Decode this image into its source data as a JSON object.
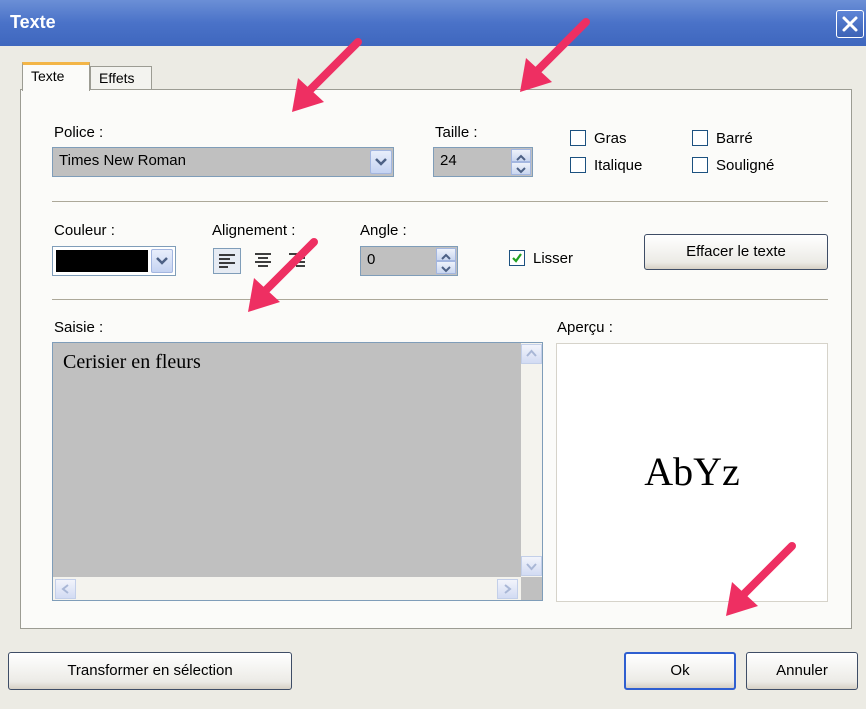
{
  "window": {
    "title": "Texte"
  },
  "tabs": [
    {
      "label": "Texte"
    },
    {
      "label": "Effets"
    }
  ],
  "font": {
    "label": "Police :",
    "value": "Times New Roman"
  },
  "size": {
    "label": "Taille :",
    "value": "24"
  },
  "styles": {
    "bold": {
      "label": "Gras",
      "checked": false
    },
    "strike": {
      "label": "Barré",
      "checked": false
    },
    "italic": {
      "label": "Italique",
      "checked": false
    },
    "underline": {
      "label": "Souligné",
      "checked": false
    }
  },
  "color": {
    "label": "Couleur :",
    "value_hex": "#000000"
  },
  "alignment": {
    "label": "Alignement :",
    "selected": "left"
  },
  "angle": {
    "label": "Angle :",
    "value": "0"
  },
  "smooth": {
    "label": "Lisser",
    "checked": true
  },
  "clear_button": {
    "label": "Effacer le texte"
  },
  "input": {
    "label": "Saisie :",
    "value": "Cerisier en fleurs"
  },
  "preview": {
    "label": "Aperçu :",
    "sample": "AbYz"
  },
  "footer": {
    "transform_label": "Transformer en sélection",
    "ok_label": "Ok",
    "cancel_label": "Annuler"
  },
  "colors": {
    "titlebar": "#4a72c8",
    "arrow": "#ee2f62",
    "tab_highlight": "#f3b547"
  }
}
